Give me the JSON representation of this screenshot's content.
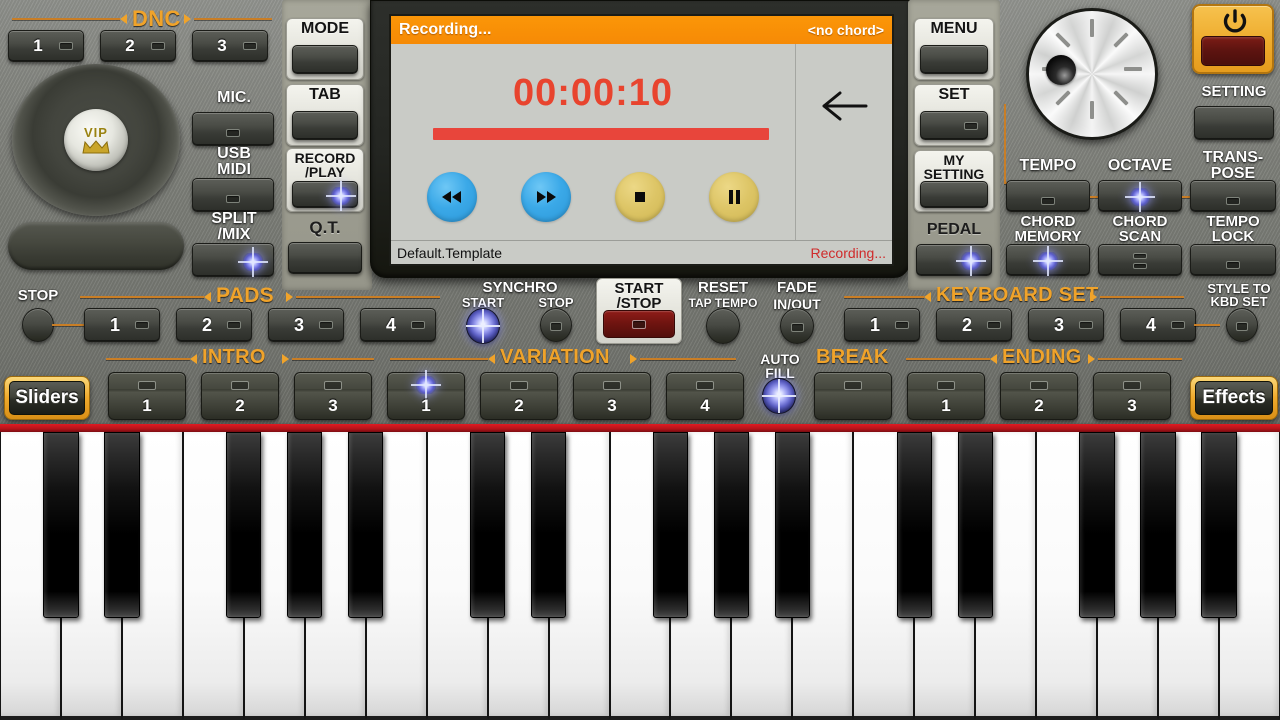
{
  "lcd": {
    "title": "Recording...",
    "chord": "<no chord>",
    "timer": "00:00:10",
    "template": "Default.Template",
    "status": "Recording...",
    "back_icon": "back-arrow-icon",
    "transport": [
      {
        "name": "rewind-button",
        "icon": "rewind-icon",
        "style": "blue"
      },
      {
        "name": "fast-forward-button",
        "icon": "fast-forward-icon",
        "style": "blue"
      },
      {
        "name": "stop-button",
        "icon": "stop-icon",
        "style": "gold"
      },
      {
        "name": "pause-button",
        "icon": "pause-icon",
        "style": "gold"
      }
    ],
    "progress_percent": 100
  },
  "dnc": {
    "label": "DNC",
    "buttons": [
      "1",
      "2",
      "3"
    ]
  },
  "joystick": {
    "logo": "VIP",
    "crown_icon": "crown-icon"
  },
  "left_column": {
    "mic": "MIC.",
    "usb_midi": "USB\nMIDI",
    "split_mix": "SPLIT\n/MIX"
  },
  "mode_column": {
    "mode": "MODE",
    "tab": "TAB",
    "record_play": "RECORD\n/PLAY",
    "qt": "Q.T."
  },
  "right_column": {
    "menu": "MENU",
    "set": "SET",
    "my_setting": "MY\nSETTING",
    "pedal": "PEDAL"
  },
  "right_panel": {
    "setting": "SETTING",
    "tempo": "TEMPO",
    "octave": "OCTAVE",
    "transpose": "TRANS-\nPOSE",
    "chord_memory": "CHORD\nMEMORY",
    "chord_scan": "CHORD\nSCAN",
    "tempo_lock": "TEMPO\nLOCK",
    "power_icon": "power-icon"
  },
  "pads": {
    "stop": "STOP",
    "label": "PADS",
    "buttons": [
      "1",
      "2",
      "3",
      "4"
    ]
  },
  "transport_row": {
    "synchro": "SYNCHRO",
    "synchro_start": "START",
    "synchro_stop": "STOP",
    "start_stop": "START\n/STOP",
    "reset": "RESET",
    "tap_tempo": "TAP TEMPO",
    "fade": "FADE",
    "in_out": "IN/OUT"
  },
  "keyboard_set": {
    "label": "KEYBOARD SET",
    "buttons": [
      "1",
      "2",
      "3",
      "4"
    ],
    "style_to_kbd": "STYLE TO\nKBD SET"
  },
  "style_row": {
    "sliders": "Sliders",
    "effects": "Effects",
    "intro_label": "INTRO",
    "intro": [
      "1",
      "2",
      "3"
    ],
    "variation_label": "VARIATION",
    "variation": [
      "1",
      "2",
      "3",
      "4"
    ],
    "auto_fill": "AUTO\nFILL",
    "break_label": "BREAK",
    "ending_label": "ENDING",
    "ending": [
      "1",
      "2",
      "3"
    ]
  },
  "colors": {
    "accent_orange": "#f0a32a",
    "lcd_header": "#fb9608",
    "timer_red": "#e8442e",
    "status_red": "#cf2b2b",
    "strip_red": "#e11b22",
    "power_amber": "#eeab2c"
  },
  "piano": {
    "white_keys": 21,
    "octaves": 3
  }
}
